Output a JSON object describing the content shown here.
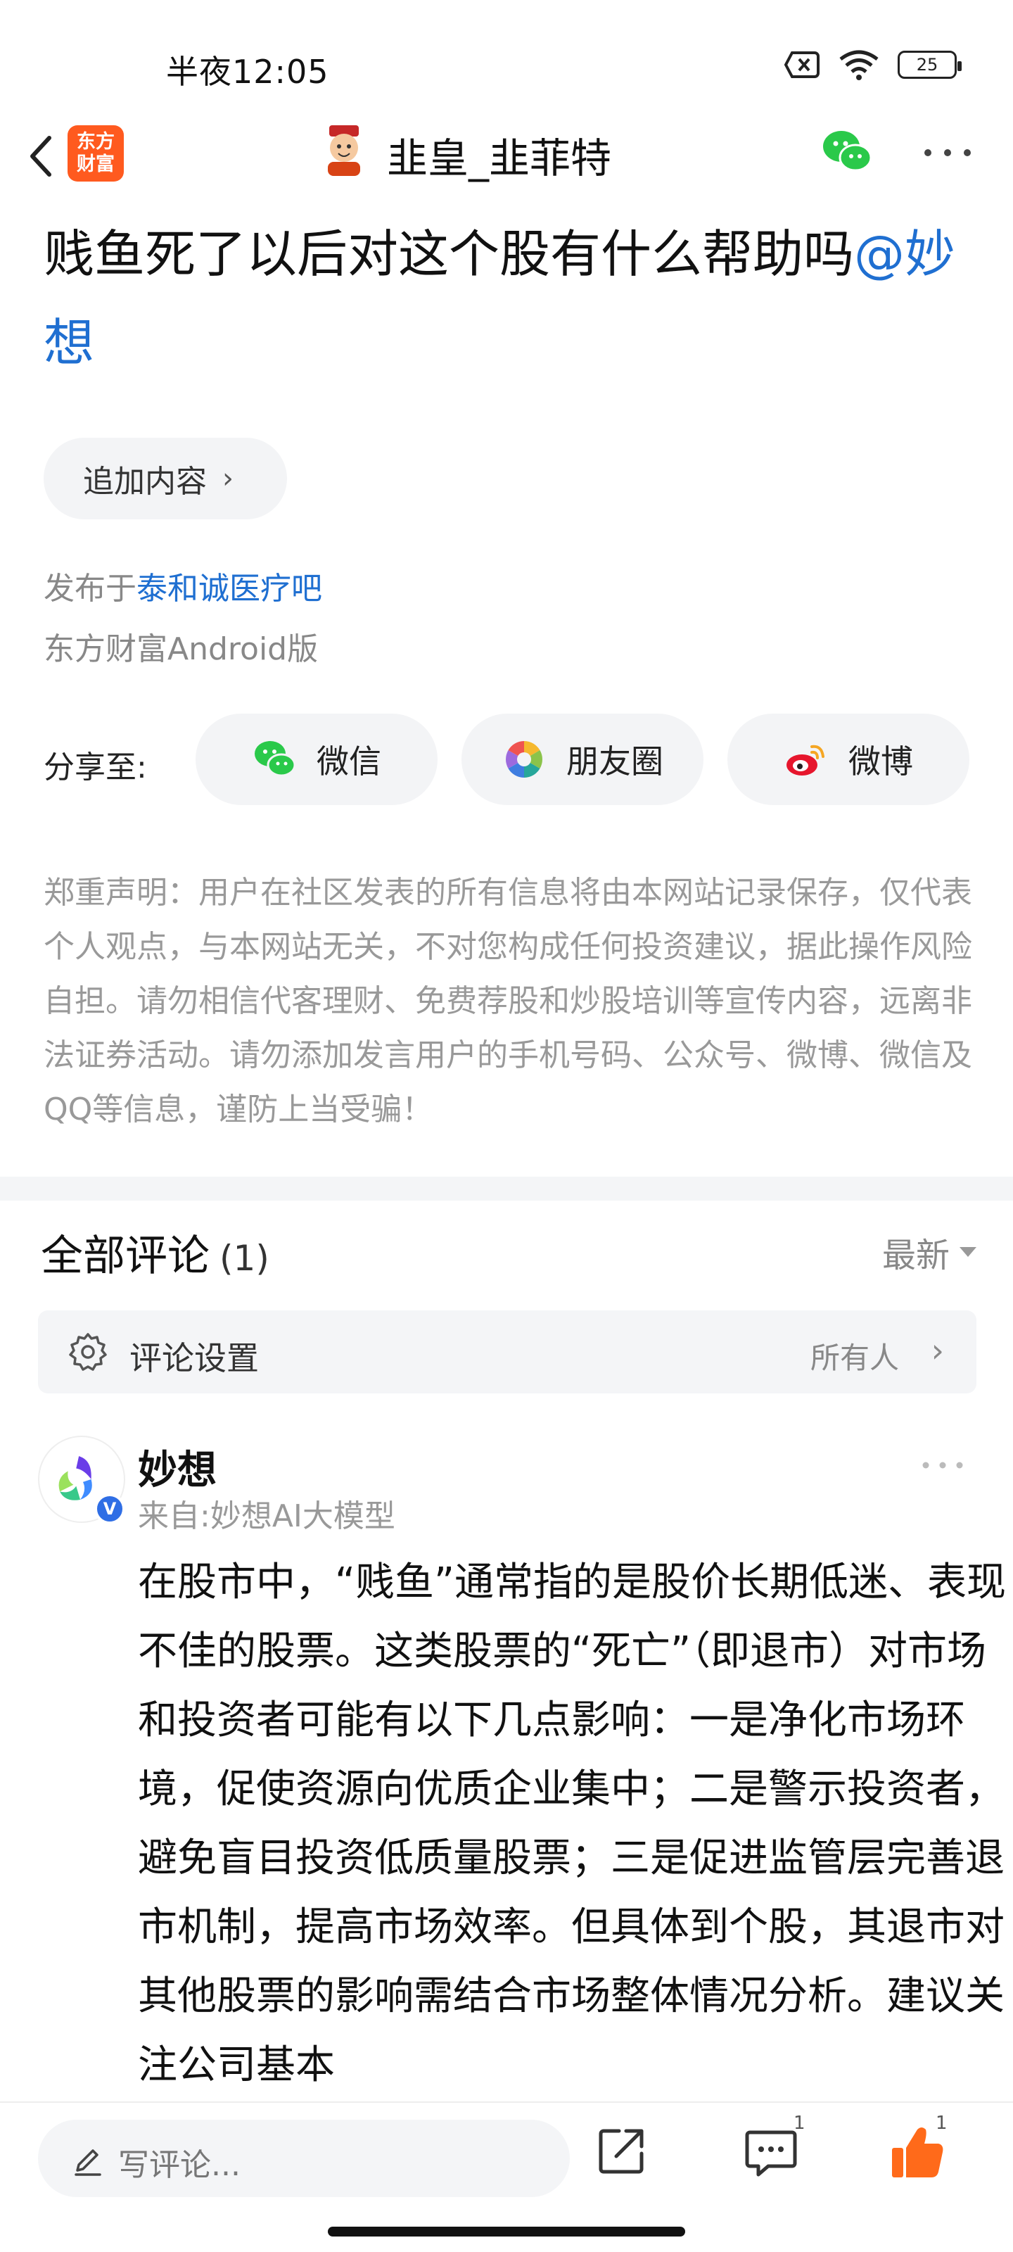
{
  "status_bar": {
    "time": "半夜12:05",
    "battery": "25"
  },
  "header": {
    "app_logo_text": "东方财富",
    "user_name": "韭皇_韭菲特"
  },
  "post": {
    "title": "贱鱼死了以后对这个股有什么帮助吗",
    "mention": "@妙想",
    "append_label": "追加内容",
    "published_prefix": "发布于",
    "forum_name": "泰和诚医疗吧",
    "client": "东方财富Android版"
  },
  "share": {
    "label": "分享至:",
    "options": [
      {
        "label": "微信",
        "icon": "wechat-icon"
      },
      {
        "label": "朋友圈",
        "icon": "moments-icon"
      },
      {
        "label": "微博",
        "icon": "weibo-icon"
      }
    ]
  },
  "disclaimer": "郑重声明：用户在社区发表的所有信息将由本网站记录保存，仅代表个人观点，与本网站无关，不对您构成任何投资建议，据此操作风险自担。请勿相信代客理财、免费荐股和炒股培训等宣传内容，远离非法证券活动。请勿添加发言用户的手机号码、公众号、微博、微信及QQ等信息，谨防上当受骗！",
  "comments": {
    "title": "全部评论",
    "count": "(1)",
    "sort_label": "最新",
    "settings_label": "评论设置",
    "settings_value": "所有人",
    "items": [
      {
        "name": "妙想",
        "source": "来自:妙想AI大模型",
        "verified": "V",
        "text": "在股市中，“贱鱼”通常指的是股价长期低迷、表现不佳的股票。这类股票的“死亡”（即退市）对市场和投资者可能有以下几点影响：一是净化市场环境，促使资源向优质企业集中；二是警示投资者，避免盲目投资低质量股票；三是促进监管层完善退市机制，提高市场效率。但具体到个股，其退市对其他股票的影响需结合市场整体情况分析。建议关注公司基本"
      }
    ]
  },
  "bottom_bar": {
    "write_placeholder": "写评论...",
    "comment_count": "1",
    "like_count": "1"
  },
  "colors": {
    "brand_orange": "#ff5a1f",
    "link_blue": "#1f6fd1",
    "like_orange": "#ff6a1a",
    "wechat_green": "#2ac94a"
  }
}
